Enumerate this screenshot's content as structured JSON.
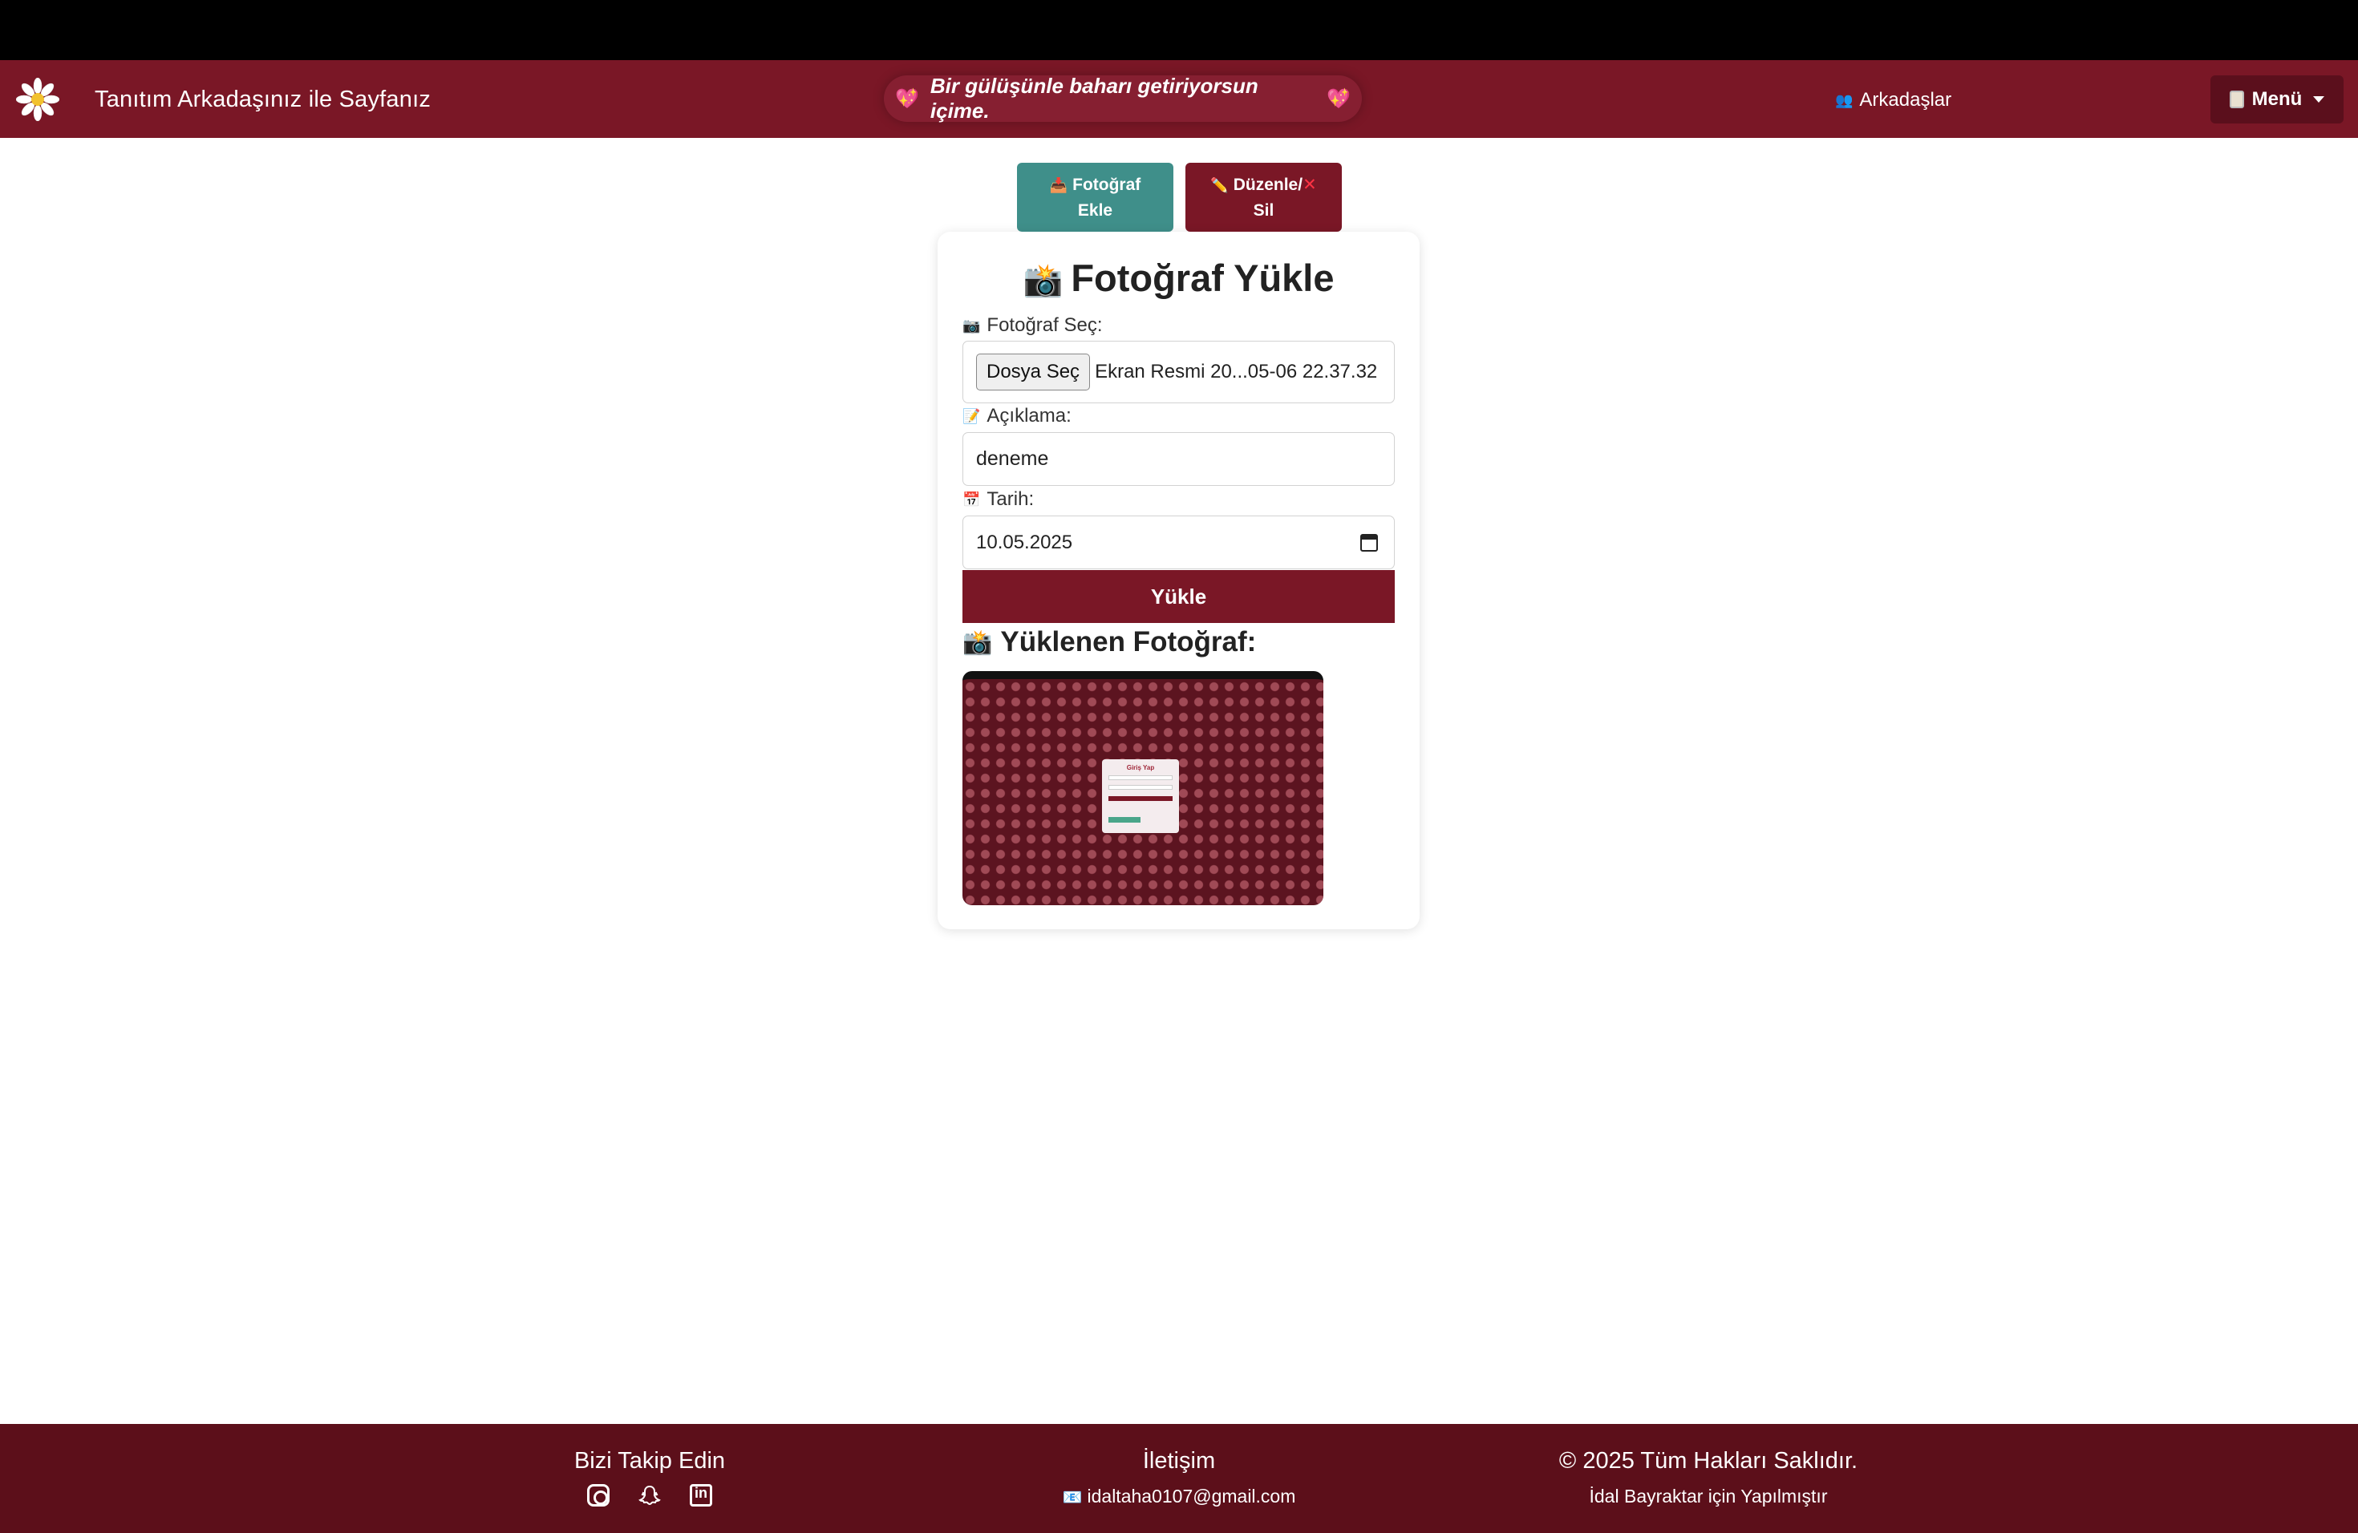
{
  "navbar": {
    "brand_title": "Tanıtım Arkadaşınız ile Sayfanız",
    "quote": "Bir gülüşünle baharı getiriyorsun içime.",
    "quote_icon": "heart-icon",
    "friends_label": "Arkadaşlar",
    "menu_label": "Menü",
    "bg_color": "#7a1726"
  },
  "actions": {
    "add_photo_line1": "Fotoğraf",
    "add_photo_line2": "Ekle",
    "edit_line1": "Düzenle/",
    "edit_line2": "Sil"
  },
  "upload_form": {
    "title": "Fotoğraf Yükle",
    "file_label": "Fotoğraf Seç:",
    "file_button": "Dosya Seç",
    "file_name": "Ekran Resmi 20...05-06 22.37.32",
    "description_label": "Açıklama:",
    "description_value": "deneme",
    "date_label": "Tarih:",
    "date_value": "10.05.2025",
    "submit_label": "Yükle"
  },
  "uploaded": {
    "title": "Yüklenen Fotoğraf:",
    "thumb_title": "Giriş Yap"
  },
  "footer": {
    "follow_title": "Bizi Takip Edin",
    "contact_title": "İletişim",
    "email": "idaltaha0107@gmail.com",
    "rights": "© 2025 Tüm Hakları Saklıdır.",
    "made_for": "İdal Bayraktar için Yapılmıştır",
    "bg_color": "#5c0f1a"
  }
}
